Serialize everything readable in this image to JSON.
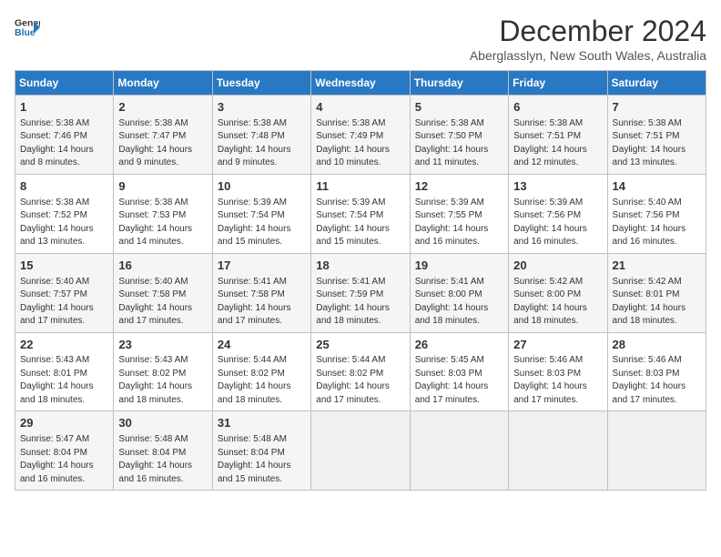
{
  "logo": {
    "text_general": "General",
    "text_blue": "Blue"
  },
  "title": "December 2024",
  "location": "Aberglasslyn, New South Wales, Australia",
  "weekdays": [
    "Sunday",
    "Monday",
    "Tuesday",
    "Wednesday",
    "Thursday",
    "Friday",
    "Saturday"
  ],
  "weeks": [
    [
      {
        "day": "1",
        "detail": "Sunrise: 5:38 AM\nSunset: 7:46 PM\nDaylight: 14 hours\nand 8 minutes."
      },
      {
        "day": "2",
        "detail": "Sunrise: 5:38 AM\nSunset: 7:47 PM\nDaylight: 14 hours\nand 9 minutes."
      },
      {
        "day": "3",
        "detail": "Sunrise: 5:38 AM\nSunset: 7:48 PM\nDaylight: 14 hours\nand 9 minutes."
      },
      {
        "day": "4",
        "detail": "Sunrise: 5:38 AM\nSunset: 7:49 PM\nDaylight: 14 hours\nand 10 minutes."
      },
      {
        "day": "5",
        "detail": "Sunrise: 5:38 AM\nSunset: 7:50 PM\nDaylight: 14 hours\nand 11 minutes."
      },
      {
        "day": "6",
        "detail": "Sunrise: 5:38 AM\nSunset: 7:51 PM\nDaylight: 14 hours\nand 12 minutes."
      },
      {
        "day": "7",
        "detail": "Sunrise: 5:38 AM\nSunset: 7:51 PM\nDaylight: 14 hours\nand 13 minutes."
      }
    ],
    [
      {
        "day": "8",
        "detail": "Sunrise: 5:38 AM\nSunset: 7:52 PM\nDaylight: 14 hours\nand 13 minutes."
      },
      {
        "day": "9",
        "detail": "Sunrise: 5:38 AM\nSunset: 7:53 PM\nDaylight: 14 hours\nand 14 minutes."
      },
      {
        "day": "10",
        "detail": "Sunrise: 5:39 AM\nSunset: 7:54 PM\nDaylight: 14 hours\nand 15 minutes."
      },
      {
        "day": "11",
        "detail": "Sunrise: 5:39 AM\nSunset: 7:54 PM\nDaylight: 14 hours\nand 15 minutes."
      },
      {
        "day": "12",
        "detail": "Sunrise: 5:39 AM\nSunset: 7:55 PM\nDaylight: 14 hours\nand 16 minutes."
      },
      {
        "day": "13",
        "detail": "Sunrise: 5:39 AM\nSunset: 7:56 PM\nDaylight: 14 hours\nand 16 minutes."
      },
      {
        "day": "14",
        "detail": "Sunrise: 5:40 AM\nSunset: 7:56 PM\nDaylight: 14 hours\nand 16 minutes."
      }
    ],
    [
      {
        "day": "15",
        "detail": "Sunrise: 5:40 AM\nSunset: 7:57 PM\nDaylight: 14 hours\nand 17 minutes."
      },
      {
        "day": "16",
        "detail": "Sunrise: 5:40 AM\nSunset: 7:58 PM\nDaylight: 14 hours\nand 17 minutes."
      },
      {
        "day": "17",
        "detail": "Sunrise: 5:41 AM\nSunset: 7:58 PM\nDaylight: 14 hours\nand 17 minutes."
      },
      {
        "day": "18",
        "detail": "Sunrise: 5:41 AM\nSunset: 7:59 PM\nDaylight: 14 hours\nand 18 minutes."
      },
      {
        "day": "19",
        "detail": "Sunrise: 5:41 AM\nSunset: 8:00 PM\nDaylight: 14 hours\nand 18 minutes."
      },
      {
        "day": "20",
        "detail": "Sunrise: 5:42 AM\nSunset: 8:00 PM\nDaylight: 14 hours\nand 18 minutes."
      },
      {
        "day": "21",
        "detail": "Sunrise: 5:42 AM\nSunset: 8:01 PM\nDaylight: 14 hours\nand 18 minutes."
      }
    ],
    [
      {
        "day": "22",
        "detail": "Sunrise: 5:43 AM\nSunset: 8:01 PM\nDaylight: 14 hours\nand 18 minutes."
      },
      {
        "day": "23",
        "detail": "Sunrise: 5:43 AM\nSunset: 8:02 PM\nDaylight: 14 hours\nand 18 minutes."
      },
      {
        "day": "24",
        "detail": "Sunrise: 5:44 AM\nSunset: 8:02 PM\nDaylight: 14 hours\nand 18 minutes."
      },
      {
        "day": "25",
        "detail": "Sunrise: 5:44 AM\nSunset: 8:02 PM\nDaylight: 14 hours\nand 17 minutes."
      },
      {
        "day": "26",
        "detail": "Sunrise: 5:45 AM\nSunset: 8:03 PM\nDaylight: 14 hours\nand 17 minutes."
      },
      {
        "day": "27",
        "detail": "Sunrise: 5:46 AM\nSunset: 8:03 PM\nDaylight: 14 hours\nand 17 minutes."
      },
      {
        "day": "28",
        "detail": "Sunrise: 5:46 AM\nSunset: 8:03 PM\nDaylight: 14 hours\nand 17 minutes."
      }
    ],
    [
      {
        "day": "29",
        "detail": "Sunrise: 5:47 AM\nSunset: 8:04 PM\nDaylight: 14 hours\nand 16 minutes."
      },
      {
        "day": "30",
        "detail": "Sunrise: 5:48 AM\nSunset: 8:04 PM\nDaylight: 14 hours\nand 16 minutes."
      },
      {
        "day": "31",
        "detail": "Sunrise: 5:48 AM\nSunset: 8:04 PM\nDaylight: 14 hours\nand 15 minutes."
      },
      {
        "day": "",
        "detail": ""
      },
      {
        "day": "",
        "detail": ""
      },
      {
        "day": "",
        "detail": ""
      },
      {
        "day": "",
        "detail": ""
      }
    ]
  ]
}
